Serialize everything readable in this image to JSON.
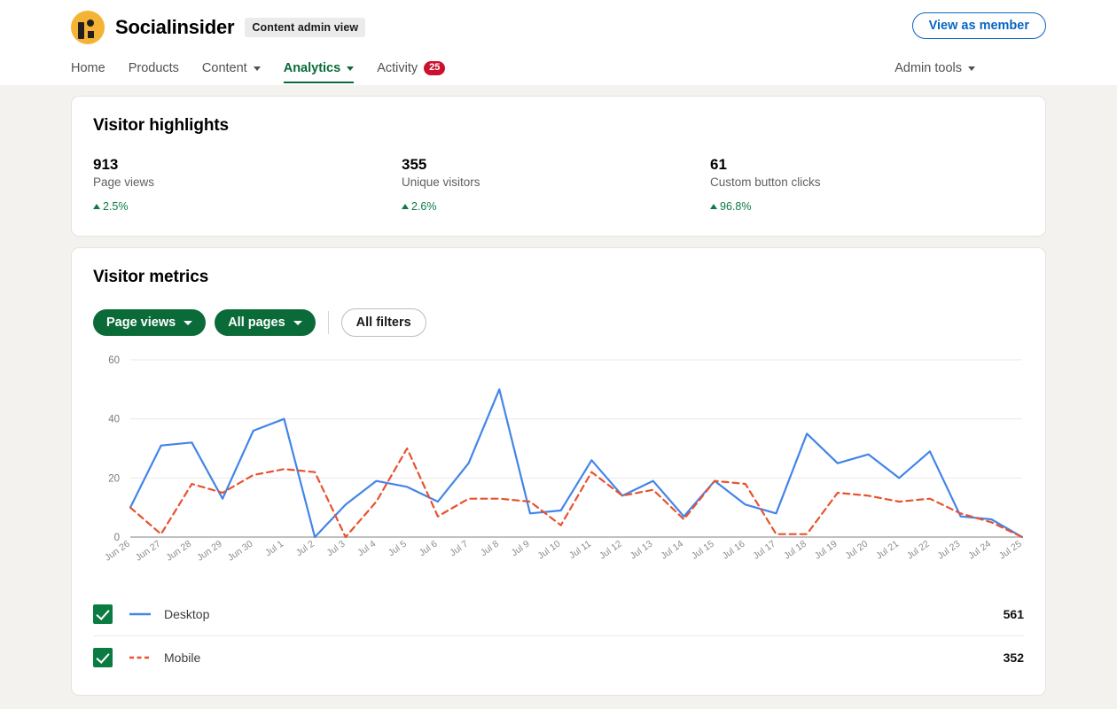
{
  "header": {
    "logo_icon": "socialinsider-logo-icon",
    "brand": "Socialinsider",
    "admin_pill": "Content admin view",
    "view_as_member": "View as member",
    "admin_tools": "Admin tools",
    "nav": [
      {
        "label": "Home",
        "caret": false,
        "active": false,
        "badge": null
      },
      {
        "label": "Products",
        "caret": false,
        "active": false,
        "badge": null
      },
      {
        "label": "Content",
        "caret": true,
        "active": false,
        "badge": null
      },
      {
        "label": "Analytics",
        "caret": true,
        "active": true,
        "badge": null
      },
      {
        "label": "Activity",
        "caret": false,
        "active": false,
        "badge": "25"
      }
    ]
  },
  "highlights": {
    "title": "Visitor highlights",
    "items": [
      {
        "value": "913",
        "label": "Page views",
        "delta": "2.5%"
      },
      {
        "value": "355",
        "label": "Unique visitors",
        "delta": "2.6%"
      },
      {
        "value": "61",
        "label": "Custom button clicks",
        "delta": "96.8%"
      }
    ]
  },
  "metrics": {
    "title": "Visitor metrics",
    "filters": {
      "metric": "Page views",
      "scope": "All pages",
      "all_filters": "All filters"
    }
  },
  "colors": {
    "green": "#0a6b39",
    "blue": "#4285e8",
    "red": "#e8522f",
    "badge_red": "#cb112d",
    "link_blue": "#0a66c2",
    "logo_orange": "#f5b335"
  },
  "chart_data": {
    "type": "line",
    "title": "Visitor metrics",
    "xlabel": "",
    "ylabel": "",
    "ylim": [
      0,
      60
    ],
    "yticks": [
      0,
      20,
      40,
      60
    ],
    "grid": true,
    "legend_position": "bottom",
    "x": [
      "Jun 26",
      "Jun 27",
      "Jun 28",
      "Jun 29",
      "Jun 30",
      "Jul 1",
      "Jul 2",
      "Jul 3",
      "Jul 4",
      "Jul 5",
      "Jul 6",
      "Jul 7",
      "Jul 8",
      "Jul 9",
      "Jul 10",
      "Jul 11",
      "Jul 12",
      "Jul 13",
      "Jul 14",
      "Jul 15",
      "Jul 16",
      "Jul 17",
      "Jul 18",
      "Jul 19",
      "Jul 20",
      "Jul 21",
      "Jul 22",
      "Jul 23",
      "Jul 24",
      "Jul 25"
    ],
    "series": [
      {
        "name": "Desktop",
        "total": "561",
        "color": "#4285e8",
        "style": "solid",
        "checked": true,
        "values": [
          10,
          31,
          32,
          13,
          36,
          40,
          0,
          11,
          19,
          17,
          12,
          25,
          50,
          8,
          9,
          26,
          14,
          19,
          7,
          19,
          11,
          8,
          35,
          25,
          28,
          20,
          29,
          7,
          6,
          0
        ]
      },
      {
        "name": "Mobile",
        "total": "352",
        "color": "#e8522f",
        "style": "dashed",
        "checked": true,
        "values": [
          10,
          1,
          18,
          15,
          21,
          23,
          22,
          0,
          12,
          30,
          7,
          13,
          13,
          12,
          4,
          22,
          14,
          16,
          6,
          19,
          18,
          1,
          1,
          15,
          14,
          12,
          13,
          8,
          5,
          0
        ]
      }
    ]
  }
}
